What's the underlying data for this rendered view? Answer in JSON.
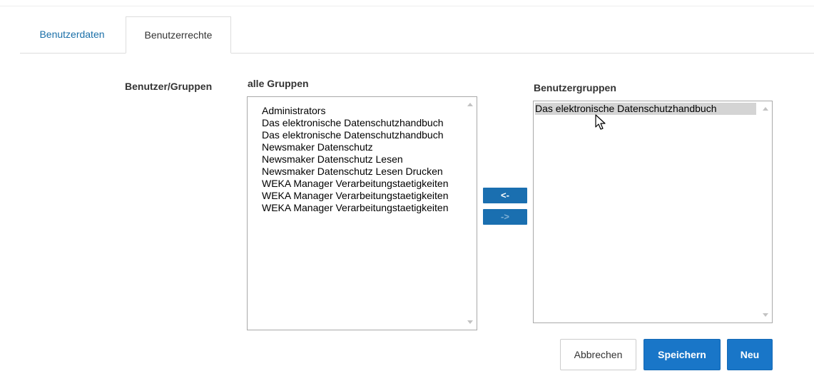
{
  "tabs": [
    {
      "label": "Benutzerdaten",
      "active": false
    },
    {
      "label": "Benutzerrechte",
      "active": true
    }
  ],
  "labels": {
    "user_groups": "Benutzer/Gruppen",
    "all_groups": "alle Gruppen",
    "member_groups": "Benutzergruppen"
  },
  "all_groups": [
    "Administrators",
    "Das elektronische Datenschutzhandbuch",
    "Das elektronische Datenschutzhandbuch",
    "Newsmaker Datenschutz",
    "Newsmaker Datenschutz Lesen",
    "Newsmaker Datenschutz Lesen Drucken",
    "WEKA Manager Verarbeitungstaetigkeiten",
    "WEKA Manager Verarbeitungstaetigkeiten",
    "WEKA Manager Verarbeitungstaetigkeiten"
  ],
  "member_groups": [
    {
      "label": "Das elektronische Datenschutzhandbuch",
      "selected": true
    }
  ],
  "move_buttons": {
    "left": "<-",
    "right": "->"
  },
  "actions": {
    "cancel": "Abbrechen",
    "save": "Speichern",
    "new": "Neu"
  },
  "colors": {
    "primary": "#1976c8",
    "move_button": "#1a6fb0",
    "tab_link": "#1a6fa8"
  },
  "icons": {
    "cursor": "mouse-pointer-icon"
  }
}
